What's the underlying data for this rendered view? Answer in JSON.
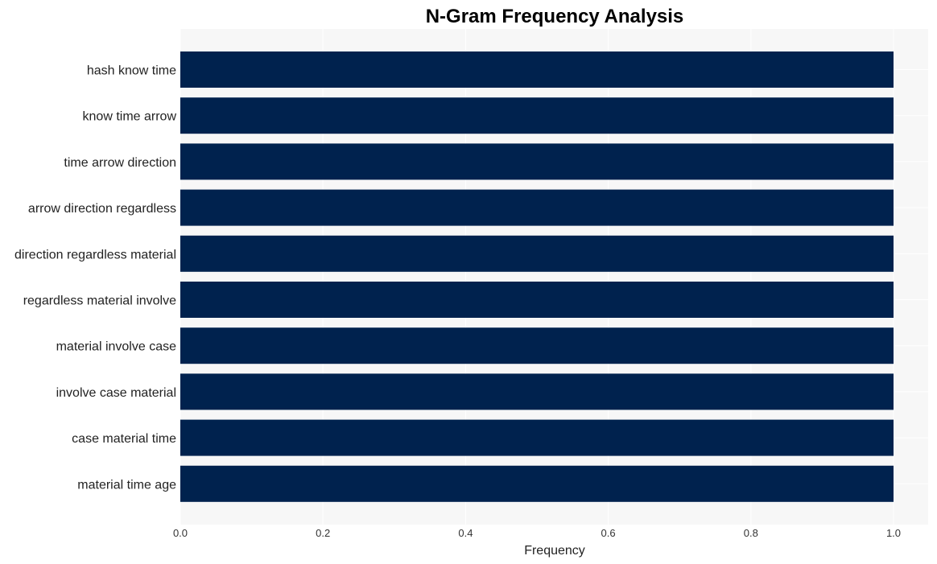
{
  "chart_data": {
    "type": "bar",
    "orientation": "horizontal",
    "title": "N-Gram Frequency Analysis",
    "xlabel": "Frequency",
    "ylabel": "",
    "categories": [
      "hash know time",
      "know time arrow",
      "time arrow direction",
      "arrow direction regardless",
      "direction regardless material",
      "regardless material involve",
      "material involve case",
      "involve case material",
      "case material time",
      "material time age"
    ],
    "values": [
      1,
      1,
      1,
      1,
      1,
      1,
      1,
      1,
      1,
      1
    ],
    "xlim": [
      0,
      1.05
    ],
    "xticks": [
      "0.0",
      "0.2",
      "0.4",
      "0.6",
      "0.8",
      "1.0"
    ],
    "grid": true,
    "legend": "none",
    "colors": {
      "bar": "#00224e",
      "plot_bg": "#f7f7f7",
      "grid": "#ffffff"
    }
  }
}
